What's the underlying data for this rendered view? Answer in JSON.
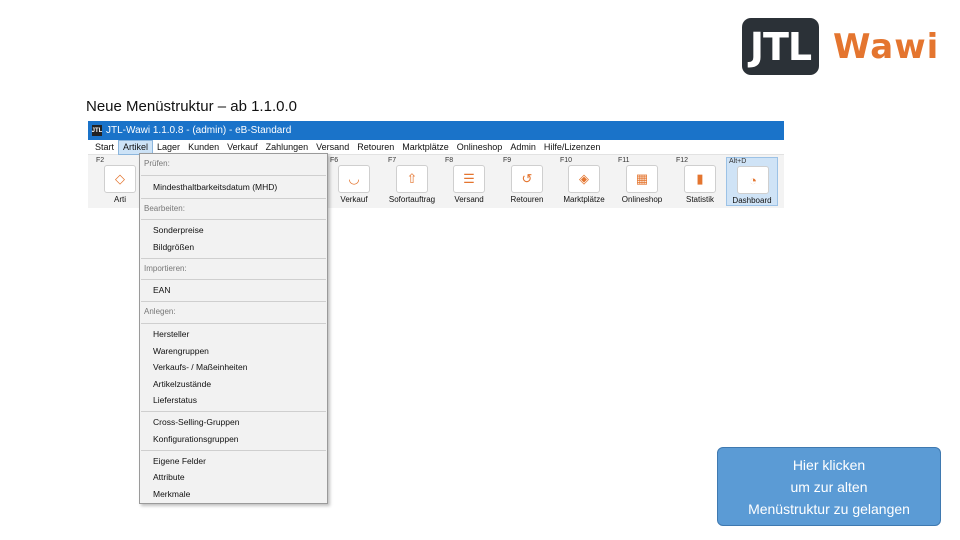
{
  "logo": {
    "mark": "JTL",
    "word": "Wawi",
    "accent_color": "#e4752f",
    "box_color": "#2b3137"
  },
  "slide_title": "Neue Menüstruktur – ab 1.1.0.0",
  "window": {
    "title": "JTL-Wawi 1.1.0.8 - (admin) - eB-Standard",
    "title_bar_color": "#1a73c9"
  },
  "menubar": [
    "Start",
    "Artikel",
    "Lager",
    "Kunden",
    "Verkauf",
    "Zahlungen",
    "Versand",
    "Retouren",
    "Marktplätze",
    "Onlineshop",
    "Admin",
    "Hilfe/Lizenzen"
  ],
  "toolbar": [
    {
      "key": "F6",
      "label": "Verkauf",
      "icon": "bag-icon"
    },
    {
      "key": "F7",
      "label": "Sofortauftrag",
      "icon": "upload-icon"
    },
    {
      "key": "F8",
      "label": "Versand",
      "icon": "truck-icon"
    },
    {
      "key": "F9",
      "label": "Retouren",
      "icon": "return-icon"
    },
    {
      "key": "F10",
      "label": "Marktplätze",
      "icon": "layers-icon"
    },
    {
      "key": "F11",
      "label": "Onlineshop",
      "icon": "shop-icon"
    },
    {
      "key": "F12",
      "label": "Statistik",
      "icon": "chart-icon"
    },
    {
      "key": "Alt+D",
      "label": "Dashboard",
      "icon": "gauge-icon"
    }
  ],
  "toolbar_left": {
    "key": "F2",
    "label": "Arti"
  },
  "dropdown": {
    "sections": [
      {
        "title": "Prüfen:",
        "items": [
          "Mindesthaltbarkeitsdatum (MHD)"
        ]
      },
      {
        "title": "Bearbeiten:",
        "items": [
          "Sonderpreise",
          "Bildgrößen"
        ]
      },
      {
        "title": "Importieren:",
        "items": [
          "EAN"
        ]
      },
      {
        "title": "Anlegen:",
        "items": [
          "Hersteller",
          "Warengruppen",
          "Verkaufs- / Maßeinheiten",
          "Artikelzustände",
          "Lieferstatus",
          "Cross-Selling-Gruppen",
          "Konfigurationsgruppen",
          "Eigene Felder",
          "Attribute",
          "Merkmale"
        ]
      }
    ]
  },
  "callout": {
    "line1": "Hier klicken",
    "line2": "um zur alten",
    "line3": "Menüstruktur zu gelangen",
    "color": "#5b9bd5"
  }
}
